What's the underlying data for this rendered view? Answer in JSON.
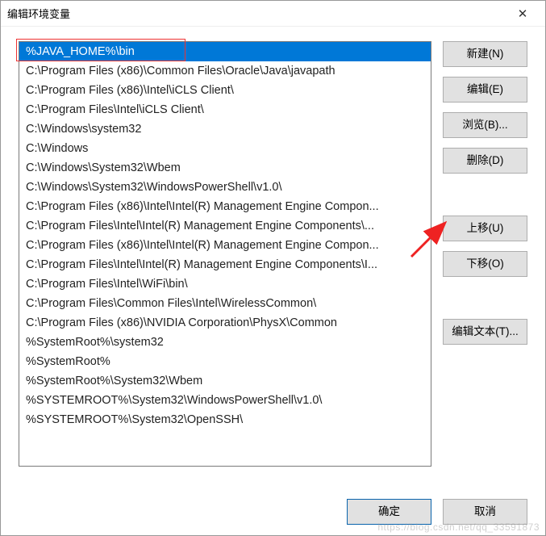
{
  "window": {
    "title": "编辑环境变量"
  },
  "list": {
    "selected_index": 0,
    "items": [
      "%JAVA_HOME%\\bin",
      "C:\\Program Files (x86)\\Common Files\\Oracle\\Java\\javapath",
      "C:\\Program Files (x86)\\Intel\\iCLS Client\\",
      "C:\\Program Files\\Intel\\iCLS Client\\",
      "C:\\Windows\\system32",
      "C:\\Windows",
      "C:\\Windows\\System32\\Wbem",
      "C:\\Windows\\System32\\WindowsPowerShell\\v1.0\\",
      "C:\\Program Files (x86)\\Intel\\Intel(R) Management Engine Compon...",
      "C:\\Program Files\\Intel\\Intel(R) Management Engine Components\\...",
      "C:\\Program Files (x86)\\Intel\\Intel(R) Management Engine Compon...",
      "C:\\Program Files\\Intel\\Intel(R) Management Engine Components\\I...",
      "C:\\Program Files\\Intel\\WiFi\\bin\\",
      "C:\\Program Files\\Common Files\\Intel\\WirelessCommon\\",
      "C:\\Program Files (x86)\\NVIDIA Corporation\\PhysX\\Common",
      "%SystemRoot%\\system32",
      "%SystemRoot%",
      "%SystemRoot%\\System32\\Wbem",
      "%SYSTEMROOT%\\System32\\WindowsPowerShell\\v1.0\\",
      "%SYSTEMROOT%\\System32\\OpenSSH\\"
    ]
  },
  "buttons": {
    "new": "新建(N)",
    "edit": "编辑(E)",
    "browse": "浏览(B)...",
    "delete": "删除(D)",
    "move_up": "上移(U)",
    "move_down": "下移(O)",
    "edit_text": "编辑文本(T)...",
    "ok": "确定",
    "cancel": "取消"
  },
  "watermark": "https://blog.csdn.net/qq_33591873"
}
